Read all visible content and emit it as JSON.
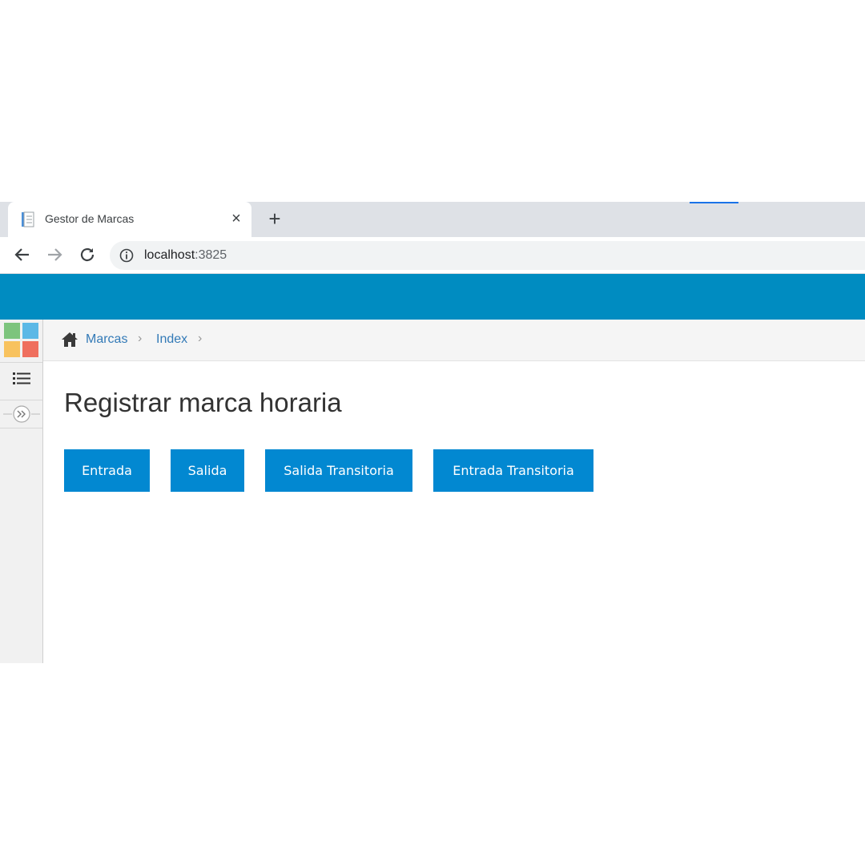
{
  "browser": {
    "tab_title": "Gestor de Marcas",
    "close_glyph": "×",
    "new_tab_glyph": "+",
    "url_host": "localhost",
    "url_port": ":3825"
  },
  "app": {
    "header_color": "#008cc1"
  },
  "sidebar": {
    "logo_colors": [
      "#7dc47d",
      "#5cb8e6",
      "#f8c25e",
      "#ef6f5e"
    ],
    "items": [
      {
        "icon": "list-icon"
      },
      {
        "icon": "double-chevron-right-icon"
      }
    ]
  },
  "breadcrumb": {
    "items": [
      "Marcas",
      "Index"
    ],
    "separator": ">"
  },
  "main": {
    "title": "Registrar marca horaria",
    "buttons": [
      "Entrada",
      "Salida",
      "Salida Transitoria",
      "Entrada Transitoria"
    ],
    "button_color": "#0288d1"
  }
}
